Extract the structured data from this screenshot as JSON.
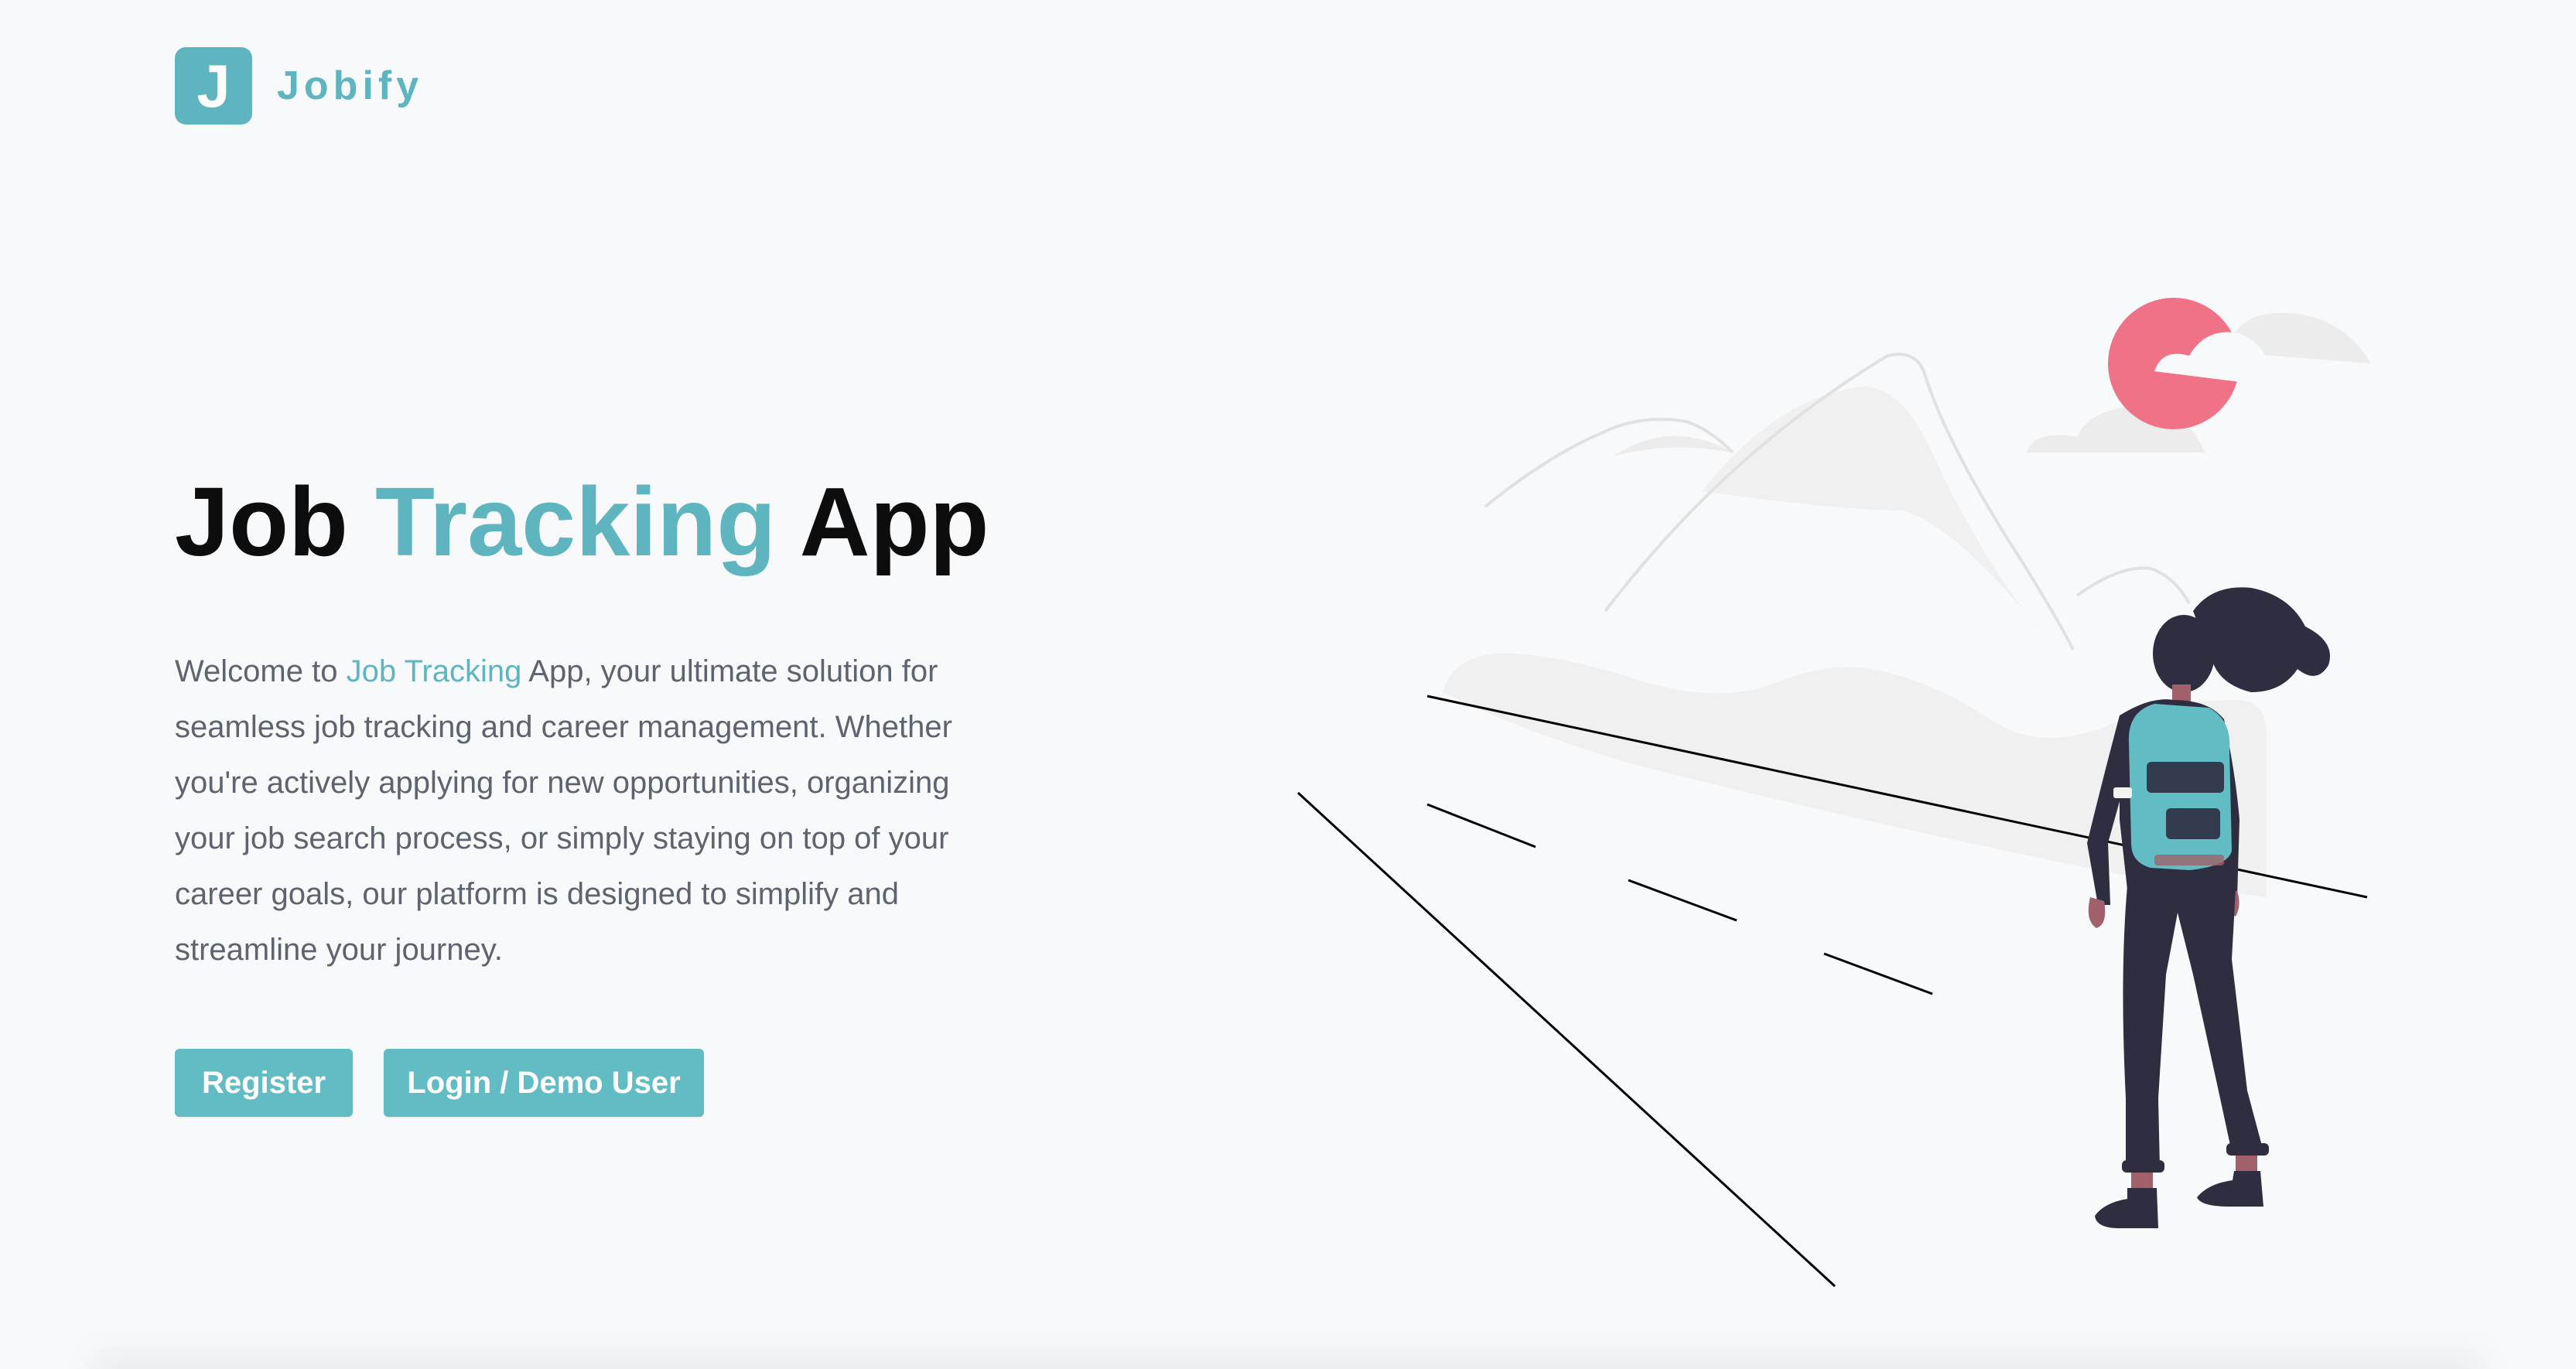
{
  "brand": {
    "logo_letter": "J",
    "name": "Jobify",
    "color": "#5fb5bf"
  },
  "hero": {
    "title_part1": "Job",
    "title_accent": "Tracking",
    "title_part2": "App",
    "desc_prefix": "Welcome to",
    "desc_accent": "Job Tracking",
    "desc_rest": "App, your ultimate solution for seamless job tracking and career management. Whether you're actively applying for new opportunities, organizing your job search process, or simply staying on top of your career goals, our platform is designed to simplify and streamline your journey."
  },
  "buttons": {
    "register": "Register",
    "login": "Login / Demo User"
  },
  "colors": {
    "accent": "#5fb5bf",
    "background": "#f8f9fb",
    "text": "#5e6370",
    "sun": "#f07287",
    "figure_dark": "#2f2e41",
    "backpack": "#62bcc4"
  },
  "illustration": {
    "icon": "woman-hiker-road-illustration"
  }
}
